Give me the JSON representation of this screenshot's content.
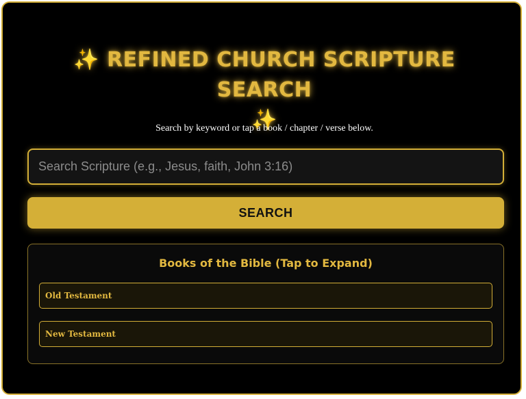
{
  "header": {
    "sparkle_left": "✨",
    "title": "REFINED CHURCH SCRIPTURE SEARCH",
    "sparkle_right": "✨",
    "subtitle": "Search by keyword or tap a book / chapter / verse below."
  },
  "search": {
    "placeholder": "Search Scripture (e.g., Jesus, faith, John 3:16)",
    "value": "",
    "button_label": "SEARCH"
  },
  "books": {
    "title": "Books of the Bible (Tap to Expand)",
    "sections": [
      {
        "label": "Old Testament"
      },
      {
        "label": "New Testament"
      }
    ]
  },
  "colors": {
    "accent": "#d4af37",
    "background": "#000000"
  }
}
